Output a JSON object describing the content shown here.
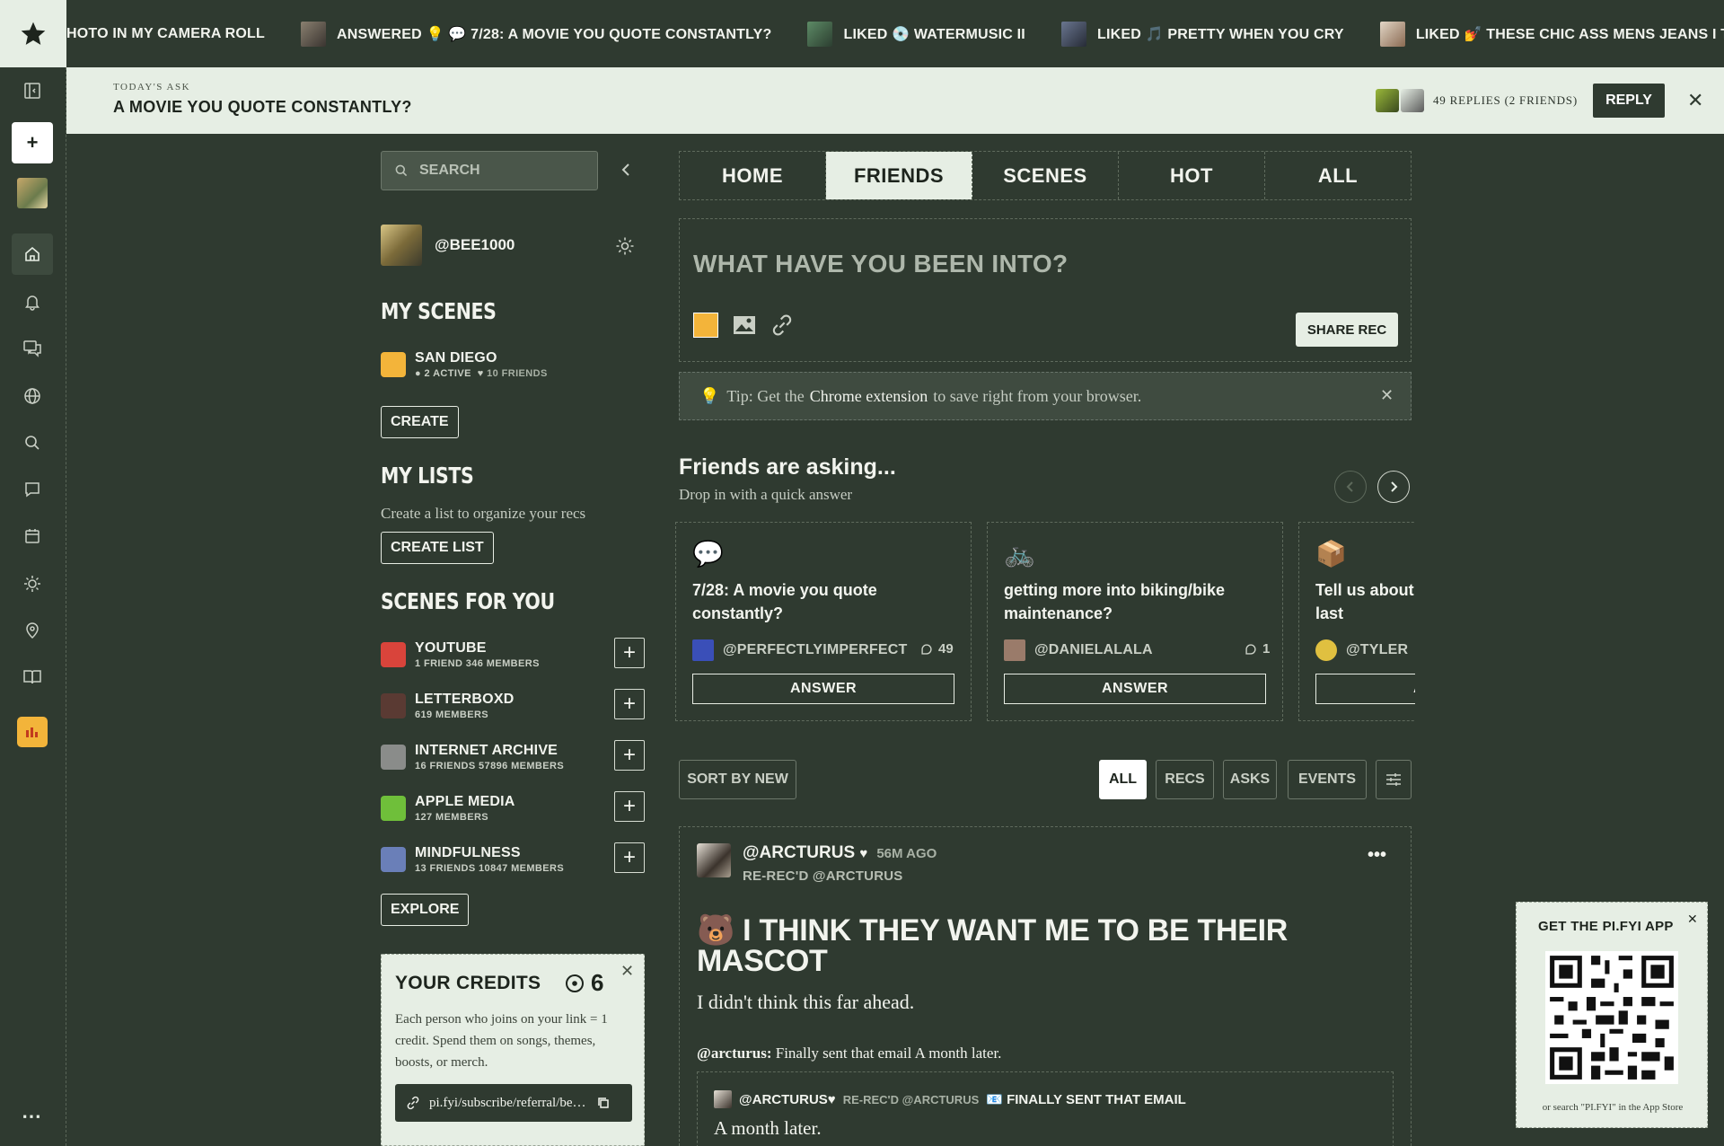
{
  "ticker": [
    {
      "text": "HOTO IN MY CAMERA ROLL",
      "color": ""
    },
    {
      "text": "ANSWERED 💡 💬 7/28: A MOVIE YOU QUOTE CONSTANTLY?",
      "color": "#6f6a5a"
    },
    {
      "text": "LIKED 💿 WATERMUSIC II",
      "color": "#3f6b4a"
    },
    {
      "text": "LIKED 🎵 PRETTY WHEN YOU CRY",
      "color": "#4b566a"
    },
    {
      "text": "LIKED 💅 THESE CHIC ASS MENS JEANS I THR",
      "color": "#c9b9a4"
    }
  ],
  "todays_ask": {
    "kicker": "TODAY'S ASK",
    "title": "A MOVIE YOU QUOTE CONSTANTLY?",
    "replies": "49 REPLIES (2 FRIENDS)",
    "reply_label": "REPLY",
    "close": "✕"
  },
  "sidebar": {
    "search_placeholder": "SEARCH",
    "username": "@BEE1000",
    "my_scenes_heading": "MY SCENES",
    "my_scenes": [
      {
        "name": "SAN DIEGO",
        "active": "2 ACTIVE",
        "friends": "10 FRIENDS"
      }
    ],
    "create_label": "CREATE",
    "my_lists_heading": "MY LISTS",
    "my_lists_hint": "Create a list to organize your recs",
    "create_list_label": "CREATE LIST",
    "scenes_for_you_heading": "SCENES FOR YOU",
    "scenes_for_you": [
      {
        "name": "YOUTUBE",
        "meta": "1 FRIEND   346 MEMBERS",
        "color": "#d9443b"
      },
      {
        "name": "LETTERBOXD",
        "meta": "619 MEMBERS",
        "color": "#5a3a33"
      },
      {
        "name": "INTERNET ARCHIVE",
        "meta": "16 FRIENDS   57896 MEMBERS",
        "color": "#8a8c8a"
      },
      {
        "name": "APPLE MEDIA",
        "meta": "127 MEMBERS",
        "color": "#6fbf3a"
      },
      {
        "name": "MINDFULNESS",
        "meta": "13 FRIENDS   10847 MEMBERS",
        "color": "#6a7fb8"
      }
    ],
    "explore_label": "EXPLORE",
    "credits": {
      "title": "YOUR CREDITS",
      "count": "6",
      "body": "Each person who joins on your link = 1 credit. Spend them on songs, themes, boosts, or merch.",
      "link": "pi.fyi/subscribe/referral/be…"
    }
  },
  "tabs": [
    {
      "label": "HOME"
    },
    {
      "label": "FRIENDS"
    },
    {
      "label": "SCENES"
    },
    {
      "label": "HOT"
    },
    {
      "label": "ALL"
    }
  ],
  "composer": {
    "placeholder": "WHAT HAVE YOU BEEN INTO?",
    "share_label": "SHARE REC"
  },
  "tip": {
    "prefix": "Tip: Get the",
    "highlight": "Chrome extension",
    "suffix": "to save right from your browser."
  },
  "friends_asking": {
    "title": "Friends are asking...",
    "subtitle": "Drop in with a quick answer",
    "cards": [
      {
        "emoji": "💬",
        "question": "7/28: A movie you quote constantly?",
        "user": "@PERFECTLYIMPERFECT",
        "count": "49",
        "answer": "ANSWER",
        "avatar_color": "#3a4fb8"
      },
      {
        "emoji": "🚲",
        "question": "getting more into biking/bike maintenance?",
        "user": "@DANIELALALA",
        "count": "1",
        "answer": "ANSWER",
        "avatar_color": "#9a7b6a"
      },
      {
        "emoji": "📦",
        "question": "Tell us about what you watched last",
        "user": "@TYLER",
        "count": "",
        "answer": "ANSWER",
        "avatar_color": "#e0c040"
      }
    ]
  },
  "feed_controls": {
    "sort": "SORT BY NEW",
    "filters": [
      "ALL",
      "RECS",
      "ASKS",
      "EVENTS"
    ]
  },
  "post": {
    "user": "@ARCTURUS",
    "heart": "♥",
    "time": "56M AGO",
    "rerec": "RE-REC'D @ARCTURUS",
    "more": "•••",
    "title": "🐻 I THINK THEY WANT ME TO BE THEIR MASCOT",
    "body": "I didn't think this far ahead.",
    "quote_user": "@arcturus:",
    "quote_text": "Finally sent that email A month later.",
    "nested_user": "@ARCTURUS♥",
    "nested_rerec": "RE-REC'D @ARCTURUS",
    "nested_title": "📧 FINALLY SENT THAT EMAIL",
    "nested_body": "A month later."
  },
  "promo": {
    "title": "GET THE PI.FYI APP",
    "close": "✕",
    "footer": "or search \"PI.FYI\" in the App Store"
  },
  "icons": {
    "rail": [
      "star-icon",
      "sidebar-toggle-icon",
      "plus-icon",
      "home-icon",
      "bell-icon",
      "messages-icon",
      "globe-icon",
      "search-icon",
      "chat-icon",
      "calendar-icon",
      "sun-icon",
      "location-icon",
      "book-icon"
    ]
  }
}
